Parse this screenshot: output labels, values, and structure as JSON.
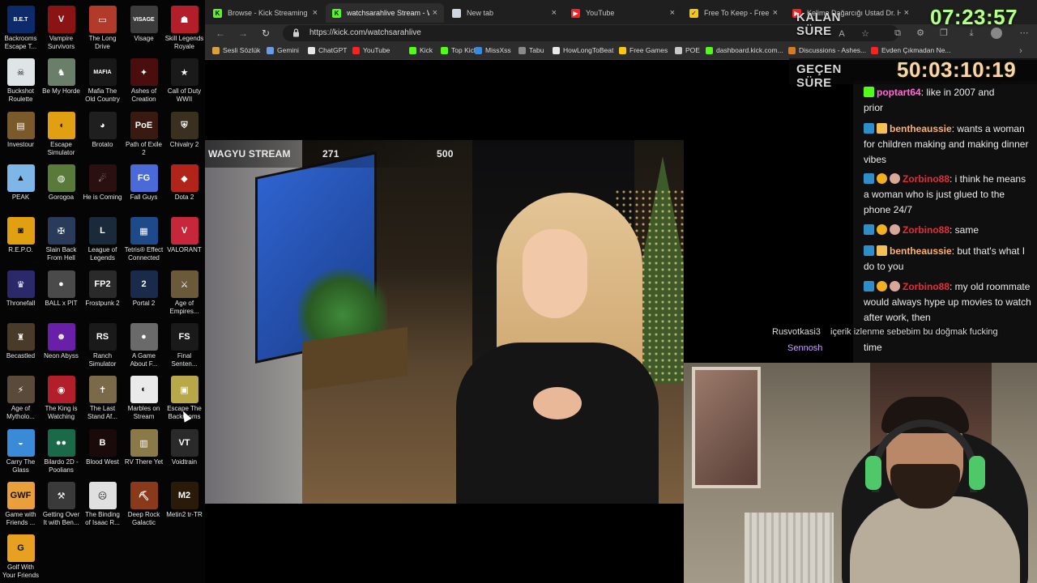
{
  "desktop": {
    "icons": [
      {
        "label": "Backrooms\nEscape T...",
        "color": "#0d2a6b",
        "glyph": "B.E.T"
      },
      {
        "label": "Vampire\nSurvivors",
        "color": "#8a1414",
        "glyph": "V"
      },
      {
        "label": "The Long\nDrive",
        "color": "#b23a2a",
        "glyph": "▭"
      },
      {
        "label": "Visage",
        "color": "#3c3c3c",
        "glyph": "VISAGE"
      },
      {
        "label": "Skill Legends\nRoyale",
        "color": "#b21f2a",
        "glyph": "☗"
      },
      {
        "label": "Buckshot\nRoulette",
        "color": "#dfe4e6",
        "glyph": "☠"
      },
      {
        "label": "Be My Horde",
        "color": "#6a7f6a",
        "glyph": "♞"
      },
      {
        "label": "Mafia The\nOld Country",
        "color": "#181818",
        "glyph": "MAFIA"
      },
      {
        "label": "Ashes of\nCreation",
        "color": "#4a0e0e",
        "glyph": "✦"
      },
      {
        "label": "Call of Duty\nWWII",
        "color": "#1a1a1a",
        "glyph": "★"
      },
      {
        "label": "Investour",
        "color": "#7a5a2a",
        "glyph": "▤"
      },
      {
        "label": "Escape\nSimulator",
        "color": "#e0a012",
        "glyph": "◖"
      },
      {
        "label": "Brotato",
        "color": "#1f1f1f",
        "glyph": "◕"
      },
      {
        "label": "Path of Exile\n2",
        "color": "#3a1a10",
        "glyph": "PoE"
      },
      {
        "label": "Chivalry 2",
        "color": "#3a3020",
        "glyph": "⛨"
      },
      {
        "label": "PEAK",
        "color": "#7fb6e8",
        "glyph": "▲"
      },
      {
        "label": "Gorogoa",
        "color": "#5a7a3a",
        "glyph": "◍"
      },
      {
        "label": "He is Coming",
        "color": "#2a1010",
        "glyph": "☄"
      },
      {
        "label": "Fall Guys",
        "color": "#4a6ad8",
        "glyph": "FG"
      },
      {
        "label": "Dota 2",
        "color": "#b2231a",
        "glyph": "◆"
      },
      {
        "label": "R.E.P.O.",
        "color": "#e0a012",
        "glyph": "◙"
      },
      {
        "label": "Slain Back\nFrom Hell",
        "color": "#2a3a5a",
        "glyph": "✠"
      },
      {
        "label": "League of\nLegends",
        "color": "#1b2a3a",
        "glyph": "L"
      },
      {
        "label": "Tetris® Effect\nConnected",
        "color": "#1f4a8a",
        "glyph": "▦"
      },
      {
        "label": "VALORANT",
        "color": "#c8263a",
        "glyph": "V"
      },
      {
        "label": "Thronefall",
        "color": "#2a2a6a",
        "glyph": "♛"
      },
      {
        "label": "BALL x PIT",
        "color": "#4a4a4a",
        "glyph": "●"
      },
      {
        "label": "Frostpunk 2",
        "color": "#2a2a2a",
        "glyph": "FP2"
      },
      {
        "label": "Portal 2",
        "color": "#1a2a4a",
        "glyph": "2"
      },
      {
        "label": "Age of\nEmpires...",
        "color": "#6a5a3a",
        "glyph": "⚔"
      },
      {
        "label": "Becastled",
        "color": "#4a3a2a",
        "glyph": "♜"
      },
      {
        "label": "Neon Abyss",
        "color": "#6a1fa8",
        "glyph": "☻"
      },
      {
        "label": "Ranch\nSimulator",
        "color": "#1a1a1a",
        "glyph": "RS"
      },
      {
        "label": "A Game\nAbout F...",
        "color": "#6a6a6a",
        "glyph": "●"
      },
      {
        "label": "Final\nSenten...",
        "color": "#1a1a1a",
        "glyph": "FS"
      },
      {
        "label": "Age of\nMytholo...",
        "color": "#5a4a3a",
        "glyph": "⚡"
      },
      {
        "label": "The King is\nWatching",
        "color": "#b21f2a",
        "glyph": "◉"
      },
      {
        "label": "The Last\nStand Af...",
        "color": "#7a6a4a",
        "glyph": "✝"
      },
      {
        "label": "Marbles on\nStream",
        "color": "#eaeaea",
        "glyph": "◐"
      },
      {
        "label": "Escape The\nBackrooms",
        "color": "#b8a84a",
        "glyph": "▣"
      },
      {
        "label": "Carry The\nGlass",
        "color": "#3a8ad8",
        "glyph": "◒"
      },
      {
        "label": "Bilardo 2D -\nPoolians",
        "color": "#1a6a4a",
        "glyph": "●●"
      },
      {
        "label": "Blood West",
        "color": "#1a0a0a",
        "glyph": "B"
      },
      {
        "label": "RV There Yet",
        "color": "#8a7a4a",
        "glyph": "▥"
      },
      {
        "label": "Voidtrain",
        "color": "#2a2a2a",
        "glyph": "VT"
      },
      {
        "label": "Game with\nFriends ...",
        "color": "#eaa03a",
        "glyph": "GWF"
      },
      {
        "label": "Getting Over\nIt with Ben...",
        "color": "#3a3a3a",
        "glyph": "⚒"
      },
      {
        "label": "The Binding\nof Isaac R...",
        "color": "#e0e0e0",
        "glyph": "☹"
      },
      {
        "label": "Deep Rock\nGalactic",
        "color": "#8a3a1a",
        "glyph": "⛏"
      },
      {
        "label": "Metin2 tr-TR",
        "color": "#2a1a0a",
        "glyph": "M2"
      },
      {
        "label": "Golf With\nYour Friends",
        "color": "#e8a020",
        "glyph": "G"
      }
    ]
  },
  "browser": {
    "tabs": [
      {
        "title": "Browse - Kick Streaming",
        "icon": "kick-icon",
        "color": "#53fc18",
        "glyph": "K"
      },
      {
        "title": "watchsarahlive Stream - Watch",
        "icon": "kick-icon",
        "color": "#53fc18",
        "glyph": "K"
      },
      {
        "title": "New tab",
        "icon": "newtab-icon",
        "color": "#cfd6e0",
        "glyph": ""
      },
      {
        "title": "YouTube",
        "icon": "youtube-icon",
        "color": "#ff1f1f",
        "glyph": "▶"
      },
      {
        "title": "Free To Keep - Free Games, Ex",
        "icon": "freegames-icon",
        "color": "#f5c518",
        "glyph": "✓"
      },
      {
        "title": "Kelime Dağarcığı Ustad Dr. Ha",
        "icon": "youtube-icon",
        "color": "#ff1f1f",
        "glyph": "▶"
      }
    ],
    "url": "https://kick.com/watchsarahlive",
    "bookmarks": [
      {
        "label": "Sesli Sözlük",
        "color": "#d8a040"
      },
      {
        "label": "Gemini",
        "color": "#6a9ae8"
      },
      {
        "label": "ChatGPT",
        "color": "#e8e8e8"
      },
      {
        "label": "YouTube",
        "color": "#ff1f1f"
      },
      {
        "label": "Kick",
        "color": "#53fc18"
      },
      {
        "label": "Top Kick",
        "color": "#53fc18"
      },
      {
        "label": "MissXss",
        "color": "#3a8ad8"
      },
      {
        "label": "Tabu",
        "color": "#8a8a8a"
      },
      {
        "label": "HowLongToBeat",
        "color": "#e8e8e8"
      },
      {
        "label": "Free Games",
        "color": "#f5c518"
      },
      {
        "label": "POE",
        "color": "#c8c8c8"
      },
      {
        "label": "dashboard.kick.com...",
        "color": "#53fc18"
      },
      {
        "label": "Discussions - Ashes...",
        "color": "#d87a20"
      },
      {
        "label": "Evden Çıkmadan Ne...",
        "color": "#ff1f1f"
      }
    ]
  },
  "stream": {
    "title": "WAGYU STREAM",
    "count_a": "271",
    "count_b": "500",
    "overlay_names": [
      "Rusvotkasi3",
      "Sennosh"
    ],
    "overlay_text": "içerik izlenme sebebim bu doğmak fucking"
  },
  "chat": {
    "messages": [
      {
        "user": "",
        "text": "prior",
        "color": "#ececec",
        "badges": []
      },
      {
        "user": "poptart64",
        "text": ": like in 2007 and",
        "color": "#ff6ad5",
        "badges": [
          "green"
        ]
      },
      {
        "user": "bentheaussie",
        "text": ": wants a woman for children making and making dinner vibes",
        "color": "#ffb36a",
        "badges": [
          "blue",
          "gift"
        ]
      },
      {
        "user": "Zorbino88",
        "text": ": i think he means a woman who is just glued to the phone 24/7",
        "color": "#e0303a",
        "badges": [
          "blue",
          "gold",
          "pfp"
        ]
      },
      {
        "user": "Zorbino88",
        "text": ": same",
        "color": "#e0303a",
        "badges": [
          "blue",
          "gold",
          "pfp"
        ]
      },
      {
        "user": "bentheaussie",
        "text": ": but that's what I do to you",
        "color": "#ffb36a",
        "badges": [
          "blue",
          "gift"
        ]
      },
      {
        "user": "Zorbino88",
        "text": ": my old roommate would always hype up movies to watch after work, then",
        "color": "#e0303a",
        "badges": [
          "blue",
          "gold",
          "pfp"
        ]
      },
      {
        "user": "",
        "text": "time",
        "color": "#ececec",
        "badges": []
      }
    ]
  },
  "overlay": {
    "remaining_label": "KALAN SÜRE",
    "remaining_time": "07:23:57",
    "elapsed_label": "GEÇEN SÜRE",
    "elapsed_time": "50:03:10:19"
  }
}
